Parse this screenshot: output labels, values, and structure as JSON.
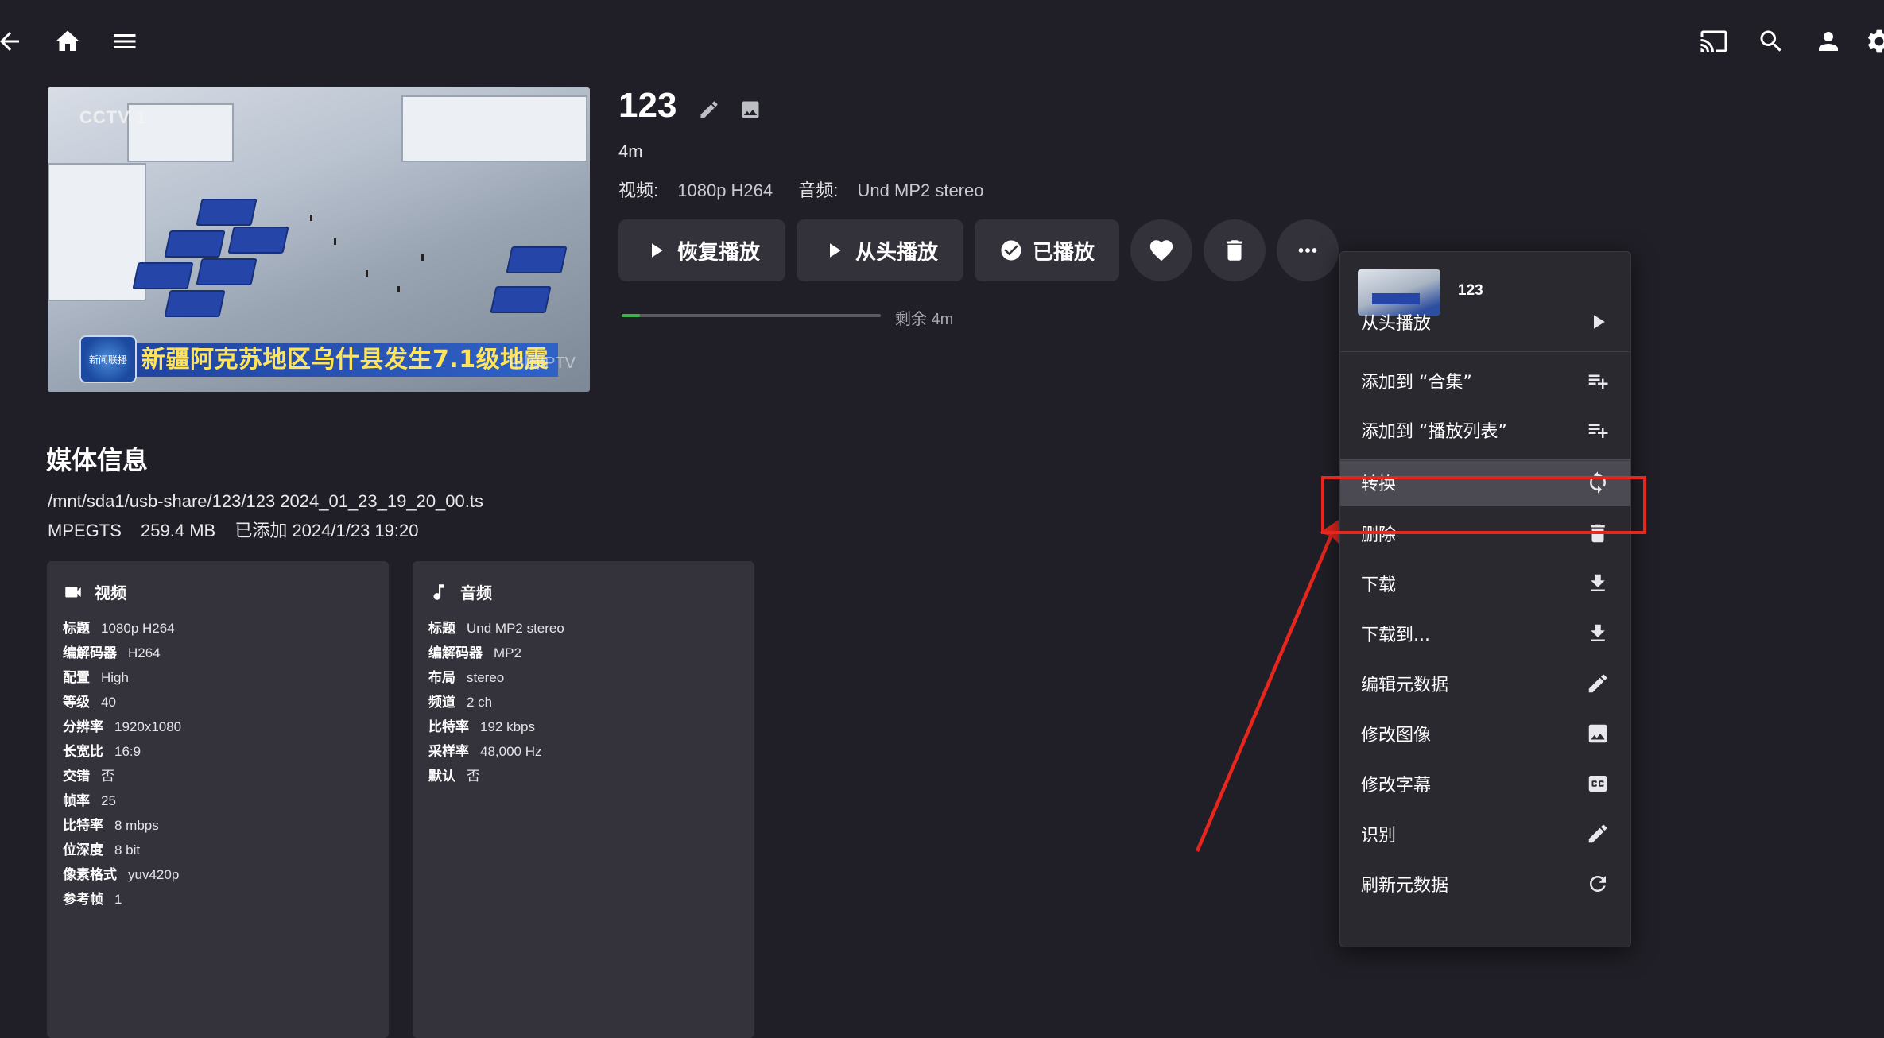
{
  "topbar": {
    "icons": [
      "back-arrow-icon",
      "home-icon",
      "menu-icon",
      "cast-icon",
      "search-icon",
      "user-icon",
      "settings-icon"
    ]
  },
  "thumbnail": {
    "channel_logo_text": "CCTV 1",
    "news_logo_text": "新闻联播",
    "caption": "新疆阿克苏地区乌什县发生7.1级地震",
    "watermark": "中国IPTV"
  },
  "item": {
    "title": "123",
    "duration": "4m",
    "video_label": "视频:",
    "video_value": "1080p H264",
    "audio_label": "音频:",
    "audio_value": "Und MP2 stereo",
    "remaining": "剩余 4m",
    "progress_fraction": 0.07
  },
  "buttons": {
    "resume": "恢复播放",
    "play_from_start": "从头播放",
    "played": "已播放"
  },
  "media_info": {
    "heading": "媒体信息",
    "path": "/mnt/sda1/usb-share/123/123 2024_01_23_19_20_00.ts",
    "container": "MPEGTS",
    "size": "259.4 MB",
    "added": "已添加 2024/1/23 19:20"
  },
  "video_card": {
    "title": "视频",
    "rows": [
      {
        "k": "标题",
        "v": "1080p H264"
      },
      {
        "k": "编解码器",
        "v": "H264"
      },
      {
        "k": "配置",
        "v": "High"
      },
      {
        "k": "等级",
        "v": "40"
      },
      {
        "k": "分辨率",
        "v": "1920x1080"
      },
      {
        "k": "长宽比",
        "v": "16:9"
      },
      {
        "k": "交错",
        "v": "否"
      },
      {
        "k": "帧率",
        "v": "25"
      },
      {
        "k": "比特率",
        "v": "8 mbps"
      },
      {
        "k": "位深度",
        "v": "8 bit"
      },
      {
        "k": "像素格式",
        "v": "yuv420p"
      },
      {
        "k": "参考帧",
        "v": "1"
      }
    ]
  },
  "audio_card": {
    "title": "音频",
    "rows": [
      {
        "k": "标题",
        "v": "Und MP2 stereo"
      },
      {
        "k": "编解码器",
        "v": "MP2"
      },
      {
        "k": "布局",
        "v": "stereo"
      },
      {
        "k": "频道",
        "v": "2 ch"
      },
      {
        "k": "比特率",
        "v": "192 kbps"
      },
      {
        "k": "采样率",
        "v": "48,000 Hz"
      },
      {
        "k": "默认",
        "v": "否"
      }
    ]
  },
  "context_menu": {
    "title": "123",
    "items": [
      {
        "label": "从头播放",
        "icon": "play-icon"
      },
      {
        "label": "添加到 “合集”",
        "icon": "playlist-add-icon"
      },
      {
        "label": "添加到 “播放列表”",
        "icon": "playlist-add-icon"
      },
      {
        "label": "转换",
        "icon": "sync-icon",
        "selected": true
      },
      {
        "label": "删除",
        "icon": "delete-icon"
      },
      {
        "label": "下载",
        "icon": "download-icon"
      },
      {
        "label": "下载到...",
        "icon": "download-icon"
      },
      {
        "label": "编辑元数据",
        "icon": "edit-icon"
      },
      {
        "label": "修改图像",
        "icon": "image-icon"
      },
      {
        "label": "修改字幕",
        "icon": "closed-caption-icon"
      },
      {
        "label": "识别",
        "icon": "edit-icon"
      },
      {
        "label": "刷新元数据",
        "icon": "refresh-icon"
      }
    ]
  },
  "colors": {
    "background": "#201f27",
    "card": "#34333c",
    "accent_progress": "#3cb04a",
    "highlight_box": "#e8261e"
  }
}
